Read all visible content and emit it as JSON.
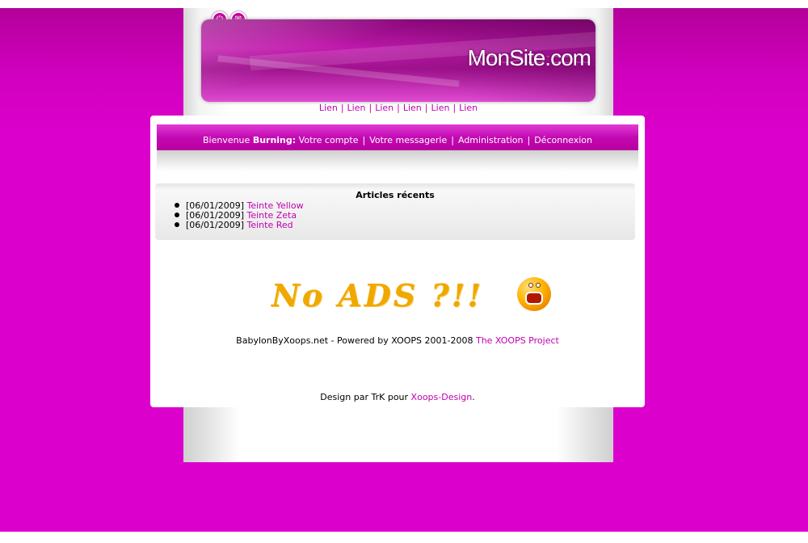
{
  "header": {
    "site_title": "MonSite.com",
    "icons": [
      "power-icon",
      "mail-icon"
    ],
    "links": [
      "Lien",
      "Lien",
      "Lien",
      "Lien",
      "Lien",
      "Lien"
    ]
  },
  "userbar": {
    "welcome": "Bienvenue",
    "username": "Burning:",
    "links": [
      "Votre compte",
      "Votre messagerie",
      "Administration",
      "Déconnexion"
    ]
  },
  "recent_articles": {
    "title": "Articles récents",
    "items": [
      {
        "date": "[06/01/2009]",
        "title": "Teinte Yellow"
      },
      {
        "date": "[06/01/2009]",
        "title": "Teinte Zeta"
      },
      {
        "date": "[06/01/2009]",
        "title": "Teinte Red"
      }
    ]
  },
  "ads": {
    "text": "No ADS ?!!",
    "icon": "screaming-face-icon"
  },
  "footer": {
    "powered_text": "BabylonByXoops.net - Powered by XOOPS 2001-2008",
    "powered_link": "The XOOPS Project",
    "design_text": "Design par TrK pour",
    "design_link": "Xoops-Design",
    "design_end": "."
  },
  "colors": {
    "background": "#dc00cc",
    "link": "#c000b0",
    "ads_text": "#f0a800"
  }
}
